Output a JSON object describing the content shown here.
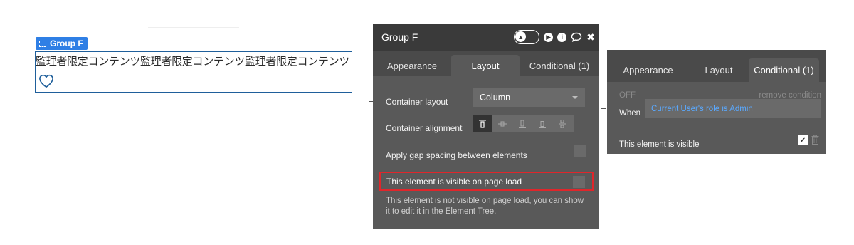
{
  "canvas": {
    "group_tag_label": "Group F",
    "group_text": "監理者限定コンテンツ監理者限定コンテンツ監理者限定コンテンツ"
  },
  "editor": {
    "title": "Group F",
    "tabs": [
      {
        "label": "Appearance",
        "active": false
      },
      {
        "label": "Layout",
        "active": true
      },
      {
        "label": "Conditional (1)",
        "active": false
      }
    ],
    "container_layout_label": "Container layout",
    "container_layout_value": "Column",
    "container_alignment_label": "Container alignment",
    "gap_spacing_label": "Apply gap spacing between elements",
    "visible_on_load_label": "This element is visible on page load",
    "visible_on_load_checked": false,
    "note": "This element is not visible on page load, you can show it to edit it in the Element Tree."
  },
  "conditional": {
    "tabs": [
      {
        "label": "Appearance",
        "active": false
      },
      {
        "label": "Layout",
        "active": false
      },
      {
        "label": "Conditional (1)",
        "active": true
      }
    ],
    "off_label": "OFF",
    "remove_label": "remove condition",
    "when_label": "When",
    "when_value": "Current User's role is Admin",
    "property_label": "This element is visible",
    "property_checked": true
  },
  "colors": {
    "accent_blue": "#2f7fe5",
    "highlight_red": "#e0262b",
    "expression_blue": "#5aa9ff"
  }
}
